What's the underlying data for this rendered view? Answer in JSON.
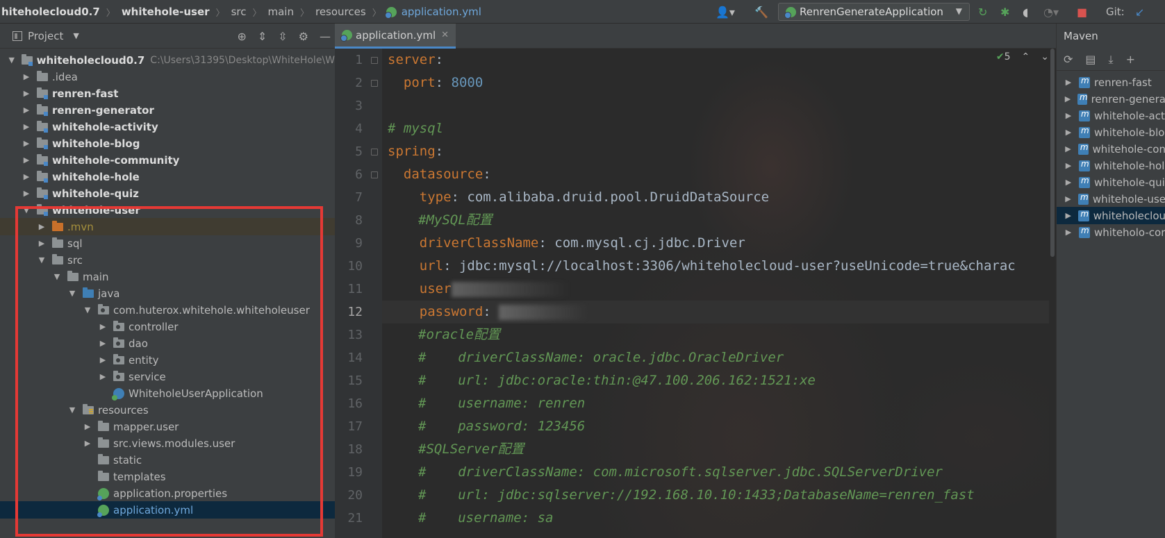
{
  "breadcrumb": {
    "items": [
      "hiteholecloud0.7",
      "whitehole-user",
      "src",
      "main",
      "resources",
      "application.yml"
    ]
  },
  "toolbar": {
    "run_config": "RenrenGenerateApplication",
    "git_label": "Git:"
  },
  "project": {
    "title": "Project",
    "tree": [
      {
        "label": "whiteholecloud0.7",
        "path": "C:\\Users\\31395\\Desktop\\WhiteHole\\W",
        "bold": true,
        "arrow": "down",
        "icon": "module"
      },
      {
        "label": ".idea",
        "arrow": "right",
        "icon": "folder"
      },
      {
        "label": "renren-fast",
        "arrow": "right",
        "icon": "module",
        "bold": true
      },
      {
        "label": "renren-generator",
        "arrow": "right",
        "icon": "module",
        "bold": true
      },
      {
        "label": "whitehole-activity",
        "arrow": "right",
        "icon": "module",
        "bold": true
      },
      {
        "label": "whitehole-blog",
        "arrow": "right",
        "icon": "module",
        "bold": true
      },
      {
        "label": "whitehole-community",
        "arrow": "right",
        "icon": "module",
        "bold": true
      },
      {
        "label": "whitehole-hole",
        "arrow": "right",
        "icon": "module",
        "bold": true
      },
      {
        "label": "whitehole-quiz",
        "arrow": "right",
        "icon": "module",
        "bold": true
      },
      {
        "label": "whitehole-user",
        "arrow": "down",
        "icon": "module",
        "bold": true
      },
      {
        "label": ".mvn",
        "arrow": "right",
        "icon": "folder-orange"
      },
      {
        "label": "sql",
        "arrow": "right",
        "icon": "folder"
      },
      {
        "label": "src",
        "arrow": "down",
        "icon": "folder"
      },
      {
        "label": "main",
        "arrow": "down",
        "icon": "folder"
      },
      {
        "label": "java",
        "arrow": "down",
        "icon": "folder-blue"
      },
      {
        "label": "com.huterox.whitehole.whiteholeuser",
        "arrow": "down",
        "icon": "package"
      },
      {
        "label": "controller",
        "arrow": "right",
        "icon": "package"
      },
      {
        "label": "dao",
        "arrow": "right",
        "icon": "package"
      },
      {
        "label": "entity",
        "arrow": "right",
        "icon": "package"
      },
      {
        "label": "service",
        "arrow": "right",
        "icon": "package"
      },
      {
        "label": "WhiteholeUserApplication",
        "icon": "spring-app"
      },
      {
        "label": "resources",
        "arrow": "down",
        "icon": "folder-resources"
      },
      {
        "label": "mapper.user",
        "arrow": "right",
        "icon": "folder"
      },
      {
        "label": "src.views.modules.user",
        "arrow": "right",
        "icon": "folder"
      },
      {
        "label": "static",
        "icon": "folder"
      },
      {
        "label": "templates",
        "icon": "folder"
      },
      {
        "label": "application.properties",
        "icon": "spring-config"
      },
      {
        "label": "application.yml",
        "icon": "spring-config"
      }
    ]
  },
  "editor": {
    "tab_label": "application.yml",
    "inspection_count": "5",
    "lines": [
      {
        "no": "1"
      },
      {
        "no": "2"
      },
      {
        "no": "3"
      },
      {
        "no": "4"
      },
      {
        "no": "5"
      },
      {
        "no": "6"
      },
      {
        "no": "7"
      },
      {
        "no": "8"
      },
      {
        "no": "9"
      },
      {
        "no": "10"
      },
      {
        "no": "11"
      },
      {
        "no": "12"
      },
      {
        "no": "13"
      },
      {
        "no": "14"
      },
      {
        "no": "15"
      },
      {
        "no": "16"
      },
      {
        "no": "17"
      },
      {
        "no": "18"
      },
      {
        "no": "19"
      },
      {
        "no": "20"
      },
      {
        "no": "21"
      }
    ],
    "code": {
      "l1_key": "server",
      "l2_key": "port",
      "l2_val": "8000",
      "l4": "# mysql",
      "l5_key": "spring",
      "l6_key": "datasource",
      "l7_key": "type",
      "l7_val": "com.alibaba.druid.pool.DruidDataSource",
      "l8": "#MySQL配置",
      "l9_key": "driverClassName",
      "l9_val": "com.mysql.cj.jdbc.Driver",
      "l10_key": "url",
      "l10_val": "jdbc:mysql://localhost:3306/whiteholecloud-user?useUnicode=true&charac",
      "l11_key": "user",
      "l12_key": "password",
      "l13": "#oracle配置",
      "l14": "#    driverClassName: oracle.jdbc.OracleDriver",
      "l15": "#    url: jdbc:oracle:thin:@47.100.206.162:1521:xe",
      "l16": "#    username: renren",
      "l17": "#    password: 123456",
      "l18": "#SQLServer配置",
      "l19": "#    driverClassName: com.microsoft.sqlserver.jdbc.SQLServerDriver",
      "l20": "#    url: jdbc:sqlserver://192.168.10.10:1433;DatabaseName=renren_fast",
      "l21": "#    username: sa"
    }
  },
  "maven": {
    "title": "Maven",
    "items": [
      "renren-fast",
      "renren-genera",
      "whitehole-act",
      "whitehole-blo",
      "whitehole-con",
      "whitehole-hol",
      "whitehole-qui",
      "whitehole-use",
      "whiteholeclou",
      "whiteholo-cor"
    ]
  },
  "colors": {
    "keyword": "#cc7832",
    "number": "#6897bb",
    "comment": "#629755",
    "selection": "#0d293e",
    "highlight_box": "#e53935"
  }
}
